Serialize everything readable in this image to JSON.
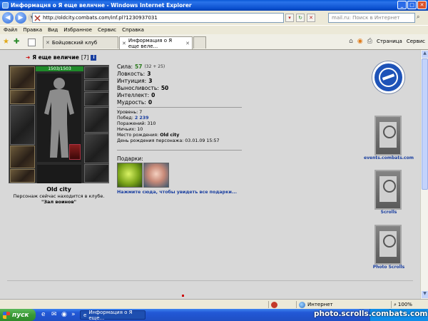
{
  "window": {
    "title": "Информацня о Я еще велнчне - Windows Internet Explorer"
  },
  "address": {
    "url": "http://oldcity.combats.com/inf.pl?1230937031",
    "search_placeholder": "mail.ru: Поиск в Интернет"
  },
  "menu": [
    "Файл",
    "Правка",
    "Вид",
    "Избранное",
    "Сервис",
    "Справка"
  ],
  "tabs": [
    {
      "label": "Бойцовский клуб"
    },
    {
      "label": "Информация о Я еще веле..."
    }
  ],
  "commandbar": {
    "page_label": "Страница",
    "tools_label": "Сервис"
  },
  "character": {
    "name": "Я еще величие",
    "level_badge": "[7]",
    "info_badge": "i",
    "hp": "1503/1503",
    "emblem_text": "",
    "city": "Old city",
    "location_text": "Персонаж сейчас находится в клубе.",
    "location_room": "\"Зал воинов\""
  },
  "stats": [
    {
      "label": "Сила:",
      "value": "57",
      "extra": "(32 + 25)"
    },
    {
      "label": "Ловкость:",
      "value": "3",
      "extra": ""
    },
    {
      "label": "Интуиция:",
      "value": "3",
      "extra": ""
    },
    {
      "label": "Выносливость:",
      "value": "50",
      "extra": ""
    },
    {
      "label": "Интеллект:",
      "value": "0",
      "extra": ""
    },
    {
      "label": "Мудрость:",
      "value": "0",
      "extra": ""
    }
  ],
  "info": {
    "level": "Уровень: 7",
    "wins_label": "Побед:",
    "wins_value": "2 239",
    "losses": "Поражений: 310",
    "draws": "Ничьих: 10",
    "birthplace_label": "Место рождения:",
    "birthplace_value": "Old city",
    "birthday": "День рождения персонажа: 03.01.09 15:57"
  },
  "gifts": {
    "label": "Подарки:",
    "link": "Нажмите сюда, чтобы увидеть все подарки..."
  },
  "sidebar": {
    "banners": [
      {
        "label": "events.combats.com"
      },
      {
        "label": "Scrolls"
      },
      {
        "label": "Photo Scrolls"
      }
    ]
  },
  "statusbar": {
    "zone": "Интернет",
    "zoom": "100%"
  },
  "taskbar": {
    "start_label": "пуск",
    "task_label": "Информация о Я еще...",
    "watermark": "photo.scrolls.combats.com"
  }
}
